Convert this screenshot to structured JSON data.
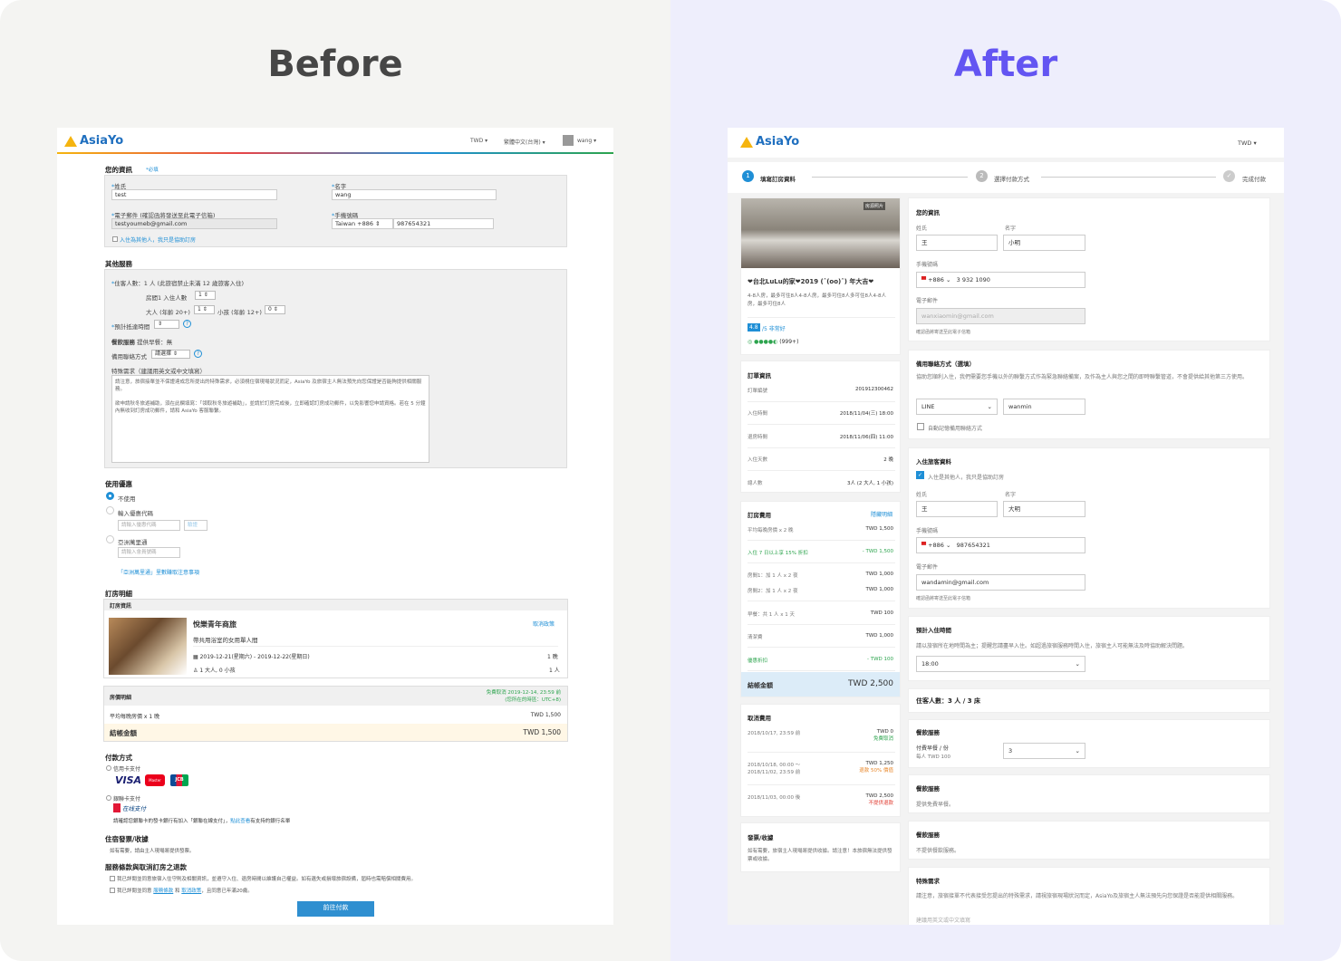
{
  "headings": {
    "before": "Before",
    "after": "After"
  },
  "colors": {
    "accent": "#1f8fd6",
    "after_heading": "#6355f2",
    "pay_button": "#2f8fd0"
  },
  "left": {
    "brand": "AsiaYo",
    "nav": {
      "currency": "TWD",
      "language": "繁體中文(台灣)",
      "user": "wang"
    },
    "your_info": {
      "title": "您的資訊",
      "required_note": "*必填",
      "lastname_label": "姓氏",
      "lastname_value": "test",
      "firstname_label": "名字",
      "firstname_value": "wang",
      "email_label": "電子郵件 (確認函將發送至此電子信箱)",
      "email_value": "testyoumeb@gmail.com",
      "phone_label": "手機號碼",
      "phone_code": "Taiwan +886",
      "phone_value": "987654321",
      "other_guest": "入住為其他人，我只是協助訂房"
    },
    "other_services": {
      "title": "其他服務",
      "guests_label": "住客人數：",
      "guests_value": "1 人 (此旅宿禁止未滿 12 歲旅客入住)",
      "room1_label": "房間1 入住人數",
      "room1_value": "1",
      "adult_label": "大人 (年齡 20+)",
      "adult_value": "1",
      "child_label": "小孩 (年齡 12+)",
      "child_value": "0",
      "arrival_label": "預計抵達時間",
      "meal_label": "餐飲服務",
      "meal_value": "提供早餐：無",
      "contact_label": "備用聯絡方式",
      "contact_value": "請選擇",
      "special_label": "特殊需求（建議用英文或中文填寫）",
      "special_p1": "請注意，旅宿接單並不保證達成您所提出的特殊需求，必須視住宿現場狀況而定，AsiaYo 及旅宿主人無法預先向您保證是否能夠提供相關服務。",
      "special_p2": "欲申請秋冬旅遊補助，須在此欄填寫：「領取秋冬旅遊補助」，並請於訂房完成後，立即確認訂房成功郵件，以免影響您申請資格。若在 5 分鐘內無收到訂房成功郵件，請和 AsiaYo 客服聯繫。"
    },
    "discount": {
      "title": "使用優惠",
      "opt1": "不使用",
      "opt2": "輸入優惠代碼",
      "coupon_placeholder": "請輸入優惠代碼",
      "verify": "驗證",
      "opt3": "亞洲萬里通",
      "miles_placeholder": "請輸入會員號碼",
      "miles_note": "「亞洲萬里通」里數賺取注意事項"
    },
    "booking": {
      "title": "訂房明細",
      "sub": "訂房資訊",
      "hotel": "悅樂青年商旅",
      "cancel_policy": "取消政策",
      "room": "帶共用浴室的女用單人間",
      "dates": "2019-12-21(星期六) - 2019-12-22(星期日)",
      "nights": "1 晚",
      "people": "1 大人, 0 小孩",
      "people_count": "1 人",
      "price_title": "房價明細",
      "free_cancel": "免費取消 2019-12-14, 23:59 前",
      "free_cancel_tz": "(您所在的時區：UTC+8)",
      "avg_label": "平均每晚房價 x 1 晚",
      "avg_value": "TWD 1,500",
      "total_label": "結帳金額",
      "total_value": "TWD 1,500"
    },
    "payment": {
      "title": "付款方式",
      "credit": "信用卡支付",
      "unionpay": "銀聯卡支付",
      "unionpay_note": "請確認您銀聯卡的發卡銀行有加入「銀聯在線支付」，",
      "unionpay_link": "點此查看",
      "unionpay_note2": "有支持的銀行名單",
      "cards": [
        "VISA",
        "Master",
        "JCB"
      ],
      "unionpay_logo": "在线支付"
    },
    "invoice": {
      "title": "住宿發票/收據",
      "text": "如有需要，請由主人現場將提供發票。"
    },
    "terms": {
      "title": "服務條款與取消訂房之退款",
      "t1": "我已詳閱並同意旅宿入住守則及相關資訊，並遵守入住、退房時間以維護自己權益。如有遺失或損壞旅宿設備，屆時也需賠償相關費用。",
      "t2a": "我已詳閱並同意",
      "t2b": "服務條款",
      "t2c": "和",
      "t2d": "取消政策",
      "t2e": "，且同意已年滿20歲。"
    },
    "pay_button": "前往付款"
  },
  "right": {
    "brand": "AsiaYo",
    "currency": "TWD",
    "steps": [
      {
        "n": "1",
        "label": "填寫訂房資料"
      },
      {
        "n": "2",
        "label": "選擇付款方式"
      },
      {
        "n": "✓",
        "label": "完成付款"
      }
    ],
    "property": {
      "photo_tag": "房源照片",
      "name": "❤台北LuLu的家❤2019 (ˆ(oo)ˆ) 年大吉❤",
      "desc": "4-8人房，最多可住8人4-8人房，最多可住8人多可住8人4-8人房，最多可住8人",
      "score": "4.8",
      "score_max": "/5",
      "score_text": "非常好",
      "reviews": "(999+)"
    },
    "order": {
      "title": "訂單資訊",
      "rows": [
        {
          "k": "訂單編號",
          "v": "201912300462"
        },
        {
          "k": "入住時間",
          "v": "2018/11/04(三) 18:00"
        },
        {
          "k": "退房時間",
          "v": "2018/11/06(四) 11:00"
        },
        {
          "k": "入住天數",
          "v": "2 晚"
        },
        {
          "k": "總人數",
          "v": "3人 (2 大人, 1 小孩)"
        }
      ]
    },
    "fees": {
      "title": "訂房費用",
      "toggle": "隱藏明細",
      "rows": [
        {
          "k": "平均每晚房價 x 2 晚",
          "v": "TWD 1,500"
        },
        {
          "k": "入住 7 日以上享 15% 折扣",
          "v": "- TWD 1,500"
        },
        {
          "k": "房間1：加 1 人 x 2 夜",
          "v": "TWD 1,000"
        },
        {
          "k": "房間2：加 1 人 x 2 夜",
          "v": "TWD 1,000"
        },
        {
          "k": "早餐：共 1 人 x 1 天",
          "v": "TWD 100"
        },
        {
          "k": "清潔費",
          "v": "TWD 1,000"
        },
        {
          "k": "優惠折扣",
          "v": "- TWD 100"
        }
      ],
      "total_label": "結帳金額",
      "total_value": "TWD 2,500"
    },
    "cancel": {
      "title": "取消費用",
      "rows": [
        {
          "k": "2018/10/17, 23:59 前",
          "v": "TWD 0",
          "note": "免費取消"
        },
        {
          "k": "2018/10/18, 00:00 ～",
          "k2": "2018/11/02, 23:59 前",
          "v": "TWD 1,250",
          "note": "退款 50% 價值"
        },
        {
          "k": "2018/11/03, 00:00 後",
          "v": "TWD 2,500",
          "note": "不提供退款"
        }
      ]
    },
    "invoice": {
      "title": "發票/收據",
      "text": "如有需要，旅宿主人現場將提供收據。請注意！本旅宿無法提供發票或收據。"
    },
    "info": {
      "title": "您的資訊",
      "last_label": "姓氏",
      "last_value": "王",
      "first_label": "名字",
      "first_value": "小明",
      "phone_label": "手機號碼",
      "phone_code": "+886",
      "phone_value": "3 932 1090",
      "email_label": "電子郵件",
      "email_value": "wanxiaomin@gmail.com",
      "email_hint": "確認函將寄送至此電子信箱"
    },
    "alt_contact": {
      "title": "備用聯絡方式（選填）",
      "desc": "協助您順利入住，我們需要您手機以外的聯繫方式作為緊急聯絡備案，及作為主人與您之間的即時聯繫管道，不會提供給其他第三方使用。",
      "method": "LINE",
      "value": "wanmin",
      "auto": "自動記憶備用聯絡方式"
    },
    "guest": {
      "title": "入住旅客資料",
      "other": "入住是其他人，我只是協助訂房",
      "last_label": "姓氏",
      "last_value": "王",
      "first_label": "名字",
      "first_value": "大明",
      "phone_label": "手機號碼",
      "phone_code": "+886",
      "phone_value": "987654321",
      "email_label": "電子郵件",
      "email_value": "wandamin@gmail.com",
      "email_hint": "確認函將寄送至此電子信箱"
    },
    "arrival": {
      "title": "預計入住時間",
      "desc": "請以旅宿所在地時間為主；提醒您請盡早入住。如超過旅宿服務時間入住，旅宿主人可能無法及時協助解決問題。",
      "value": "18:00"
    },
    "guests_count": "住客人數：3 人 / 3 床",
    "meal1": {
      "title": "餐飲服務",
      "item": "付費早餐 / 份",
      "price": "每人 TWD 100",
      "qty": "3"
    },
    "meal2": {
      "title": "餐飲服務",
      "text": "提供免費早餐。"
    },
    "meal3": {
      "title": "餐飲服務",
      "text": "不提供餐飲服務。"
    },
    "special": {
      "title": "特殊需求",
      "text": "請注意，旅宿接單不代表接受您提出的特殊需求，請視旅宿現場狀況而定，AsiaYo及旅宿主人無法預先向您保證是否能提供相關服務。",
      "placeholder": "建議用英文或中文填寫"
    }
  }
}
